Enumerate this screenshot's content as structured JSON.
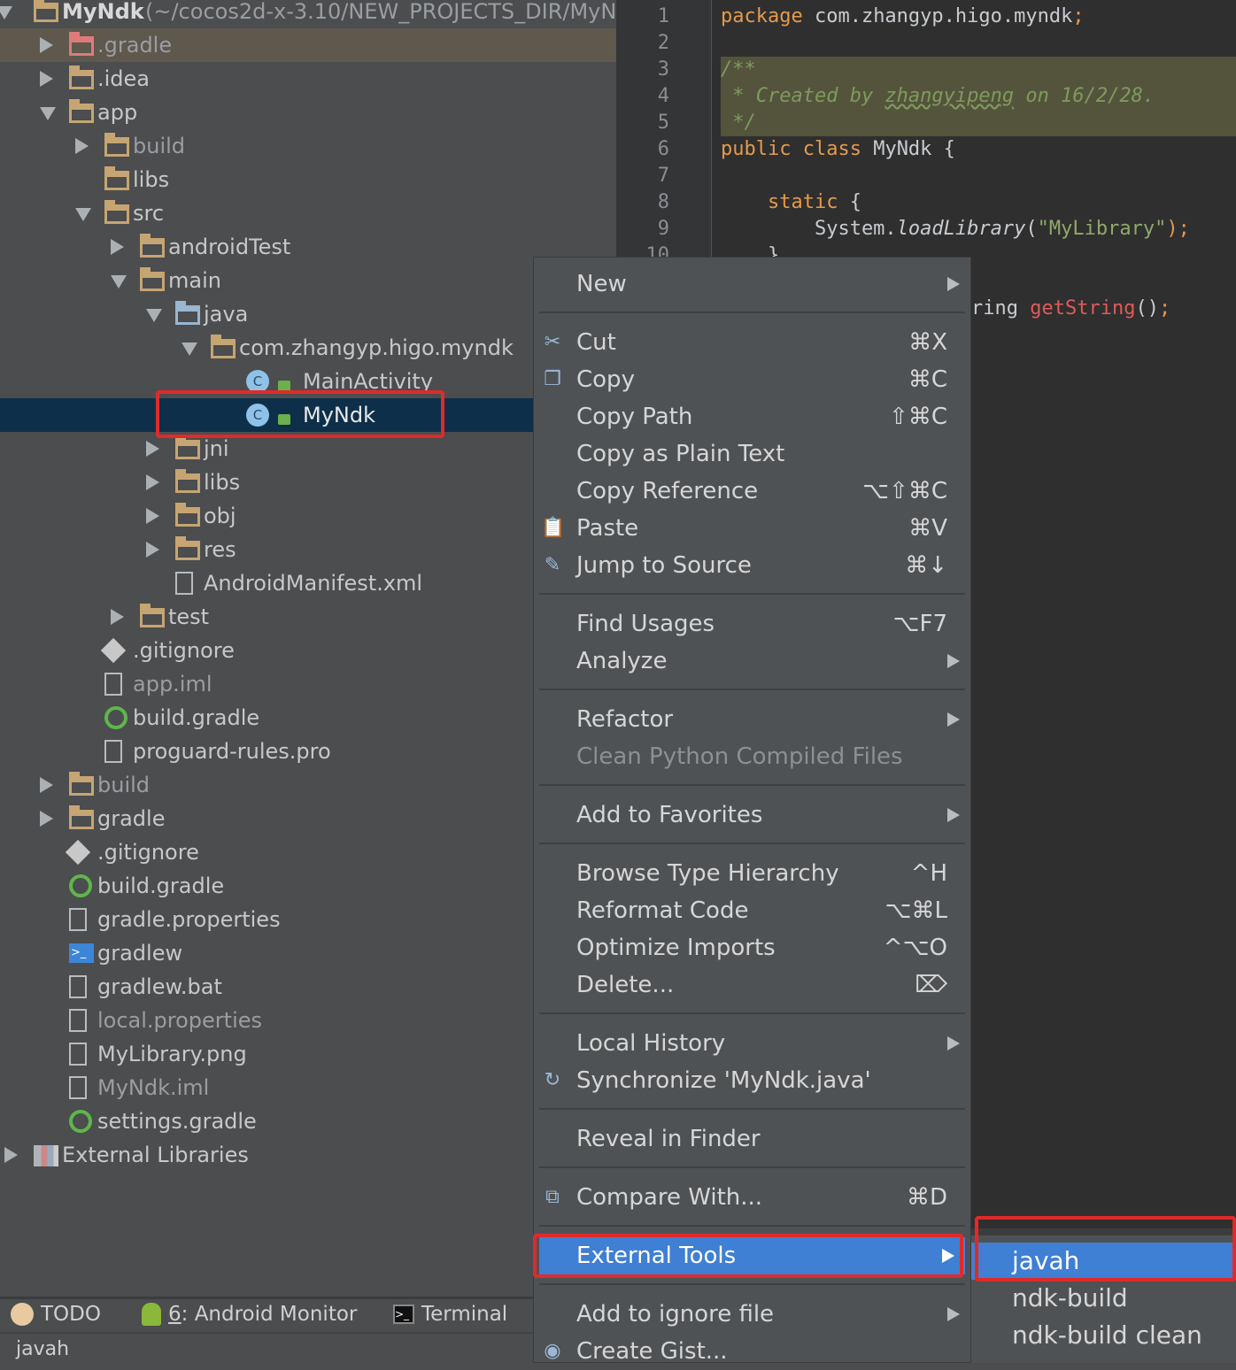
{
  "project_tree": {
    "root": {
      "name": "MyNdk",
      "path": "(~/cocos2d-x-3.10/NEW_PROJECTS_DIR/MyN"
    },
    "items": [
      {
        "label": ".gradle",
        "level": 1,
        "arrow": "right",
        "icon": "excluded-folder-icon",
        "style": "excluded"
      },
      {
        "label": ".idea",
        "level": 1,
        "arrow": "right",
        "icon": "folder-icon"
      },
      {
        "label": "app",
        "level": 1,
        "arrow": "down",
        "icon": "module-folder-icon"
      },
      {
        "label": "build",
        "level": 2,
        "arrow": "right",
        "icon": "folder-icon",
        "style": "dim"
      },
      {
        "label": "libs",
        "level": 2,
        "arrow": "",
        "icon": "folder-icon"
      },
      {
        "label": "src",
        "level": 2,
        "arrow": "down",
        "icon": "folder-icon"
      },
      {
        "label": "androidTest",
        "level": 3,
        "arrow": "right",
        "icon": "folder-icon"
      },
      {
        "label": "main",
        "level": 3,
        "arrow": "down",
        "icon": "folder-icon"
      },
      {
        "label": "java",
        "level": 4,
        "arrow": "down",
        "icon": "source-folder-icon"
      },
      {
        "label": "com.zhangyp.higo.myndk",
        "level": 5,
        "arrow": "down",
        "icon": "package-icon"
      },
      {
        "label": "MainActivity",
        "level": 6,
        "arrow": "",
        "icon": "class-icon"
      },
      {
        "label": "MyNdk",
        "level": 6,
        "arrow": "",
        "icon": "class-icon",
        "style": "selected"
      },
      {
        "label": "jni",
        "level": 4,
        "arrow": "right",
        "icon": "folder-icon"
      },
      {
        "label": "libs",
        "level": 4,
        "arrow": "right",
        "icon": "folder-icon"
      },
      {
        "label": "obj",
        "level": 4,
        "arrow": "right",
        "icon": "folder-icon"
      },
      {
        "label": "res",
        "level": 4,
        "arrow": "right",
        "icon": "resource-folder-icon"
      },
      {
        "label": "AndroidManifest.xml",
        "level": 4,
        "arrow": "",
        "icon": "xml-file-icon"
      },
      {
        "label": "test",
        "level": 3,
        "arrow": "right",
        "icon": "folder-icon"
      },
      {
        "label": ".gitignore",
        "level": 2,
        "arrow": "",
        "icon": "gitignore-icon"
      },
      {
        "label": "app.iml",
        "level": 2,
        "arrow": "",
        "icon": "iml-file-icon",
        "style": "dim"
      },
      {
        "label": "build.gradle",
        "level": 2,
        "arrow": "",
        "icon": "gradle-icon"
      },
      {
        "label": "proguard-rules.pro",
        "level": 2,
        "arrow": "",
        "icon": "text-file-icon"
      },
      {
        "label": "build",
        "level": 1,
        "arrow": "right",
        "icon": "folder-icon",
        "style": "dim"
      },
      {
        "label": "gradle",
        "level": 1,
        "arrow": "right",
        "icon": "folder-icon"
      },
      {
        "label": ".gitignore",
        "level": 1,
        "arrow": "",
        "icon": "gitignore-icon"
      },
      {
        "label": "build.gradle",
        "level": 1,
        "arrow": "",
        "icon": "gradle-icon"
      },
      {
        "label": "gradle.properties",
        "level": 1,
        "arrow": "",
        "icon": "properties-file-icon"
      },
      {
        "label": "gradlew",
        "level": 1,
        "arrow": "",
        "icon": "script-icon"
      },
      {
        "label": "gradlew.bat",
        "level": 1,
        "arrow": "",
        "icon": "text-file-icon"
      },
      {
        "label": "local.properties",
        "level": 1,
        "arrow": "",
        "icon": "properties-file-icon",
        "style": "dim"
      },
      {
        "label": "MyLibrary.png",
        "level": 1,
        "arrow": "",
        "icon": "image-file-icon"
      },
      {
        "label": "MyNdk.iml",
        "level": 1,
        "arrow": "",
        "icon": "iml-file-icon",
        "style": "dim"
      },
      {
        "label": "settings.gradle",
        "level": 1,
        "arrow": "",
        "icon": "gradle-icon"
      },
      {
        "label": "External Libraries",
        "level": 0,
        "arrow": "right",
        "icon": "libraries-icon"
      }
    ]
  },
  "editor": {
    "line_numbers": [
      "1",
      "2",
      "3",
      "4",
      "5",
      "6",
      "7",
      "8",
      "9",
      "10"
    ],
    "lines": {
      "l1_kw": "package",
      "l1_rest": " com.zhangyp.higo.myndk",
      "l1_semi": ";",
      "l3": "/**",
      "l4_a": " * Created by ",
      "l4_b": "zhangyipeng",
      "l4_c": " on 16/2/28.",
      "l5": " */",
      "l6_kw": "public class",
      "l6_rest": " MyNdk {",
      "l8_kw": "    static",
      "l8_rest": " {",
      "l9_a": "        System.",
      "l9_b": "loadLibrary",
      "l9_c": "(",
      "l9_d": "\"MyLibrary\"",
      "l9_e": ");",
      "l10": "    }",
      "l12_a": "ring ",
      "l12_b": "getString",
      "l12_c": "()",
      "l12_d": ";"
    }
  },
  "context_menu": {
    "groups": [
      [
        {
          "label": "New",
          "submenu": true
        }
      ],
      [
        {
          "label": "Cut",
          "shortcut": "⌘X",
          "icon": "scissors-icon"
        },
        {
          "label": "Copy",
          "shortcut": "⌘C",
          "icon": "copy-icon"
        },
        {
          "label": "Copy Path",
          "shortcut": "⇧⌘C"
        },
        {
          "label": "Copy as Plain Text"
        },
        {
          "label": "Copy Reference",
          "shortcut": "⌥⇧⌘C"
        },
        {
          "label": "Paste",
          "shortcut": "⌘V",
          "icon": "paste-icon"
        },
        {
          "label": "Jump to Source",
          "shortcut": "⌘↓",
          "icon": "edit-icon"
        }
      ],
      [
        {
          "label": "Find Usages",
          "shortcut": "⌥F7"
        },
        {
          "label": "Analyze",
          "submenu": true
        }
      ],
      [
        {
          "label": "Refactor",
          "submenu": true
        },
        {
          "label": "Clean Python Compiled Files",
          "disabled": true
        }
      ],
      [
        {
          "label": "Add to Favorites",
          "submenu": true
        }
      ],
      [
        {
          "label": "Browse Type Hierarchy",
          "shortcut": "^H"
        },
        {
          "label": "Reformat Code",
          "shortcut": "⌥⌘L"
        },
        {
          "label": "Optimize Imports",
          "shortcut": "^⌥O"
        },
        {
          "label": "Delete...",
          "shortcut": "⌦"
        }
      ],
      [
        {
          "label": "Local History",
          "submenu": true
        },
        {
          "label": "Synchronize 'MyNdk.java'",
          "icon": "sync-icon"
        }
      ],
      [
        {
          "label": "Reveal in Finder"
        }
      ],
      [
        {
          "label": "Compare With...",
          "shortcut": "⌘D",
          "icon": "compare-icon"
        }
      ],
      [
        {
          "label": "External Tools",
          "submenu": true,
          "active": true
        }
      ],
      [
        {
          "label": "Add to ignore file",
          "submenu": true
        },
        {
          "label": "Create Gist...",
          "icon": "github-icon"
        }
      ]
    ]
  },
  "external_tools_submenu": {
    "items": [
      {
        "label": "javah",
        "active": true
      },
      {
        "label": "ndk-build"
      },
      {
        "label": "ndk-build clean"
      }
    ]
  },
  "tool_windows": {
    "todo": "TODO",
    "android_monitor_num": "6",
    "android_monitor": ": Android Monitor",
    "terminal": "Terminal"
  },
  "status_bar": {
    "text": "javah"
  },
  "colors": {
    "highlight": "#3f7fd4",
    "annotation_box": "#e02a2a",
    "selection": "#0d2f4a"
  }
}
